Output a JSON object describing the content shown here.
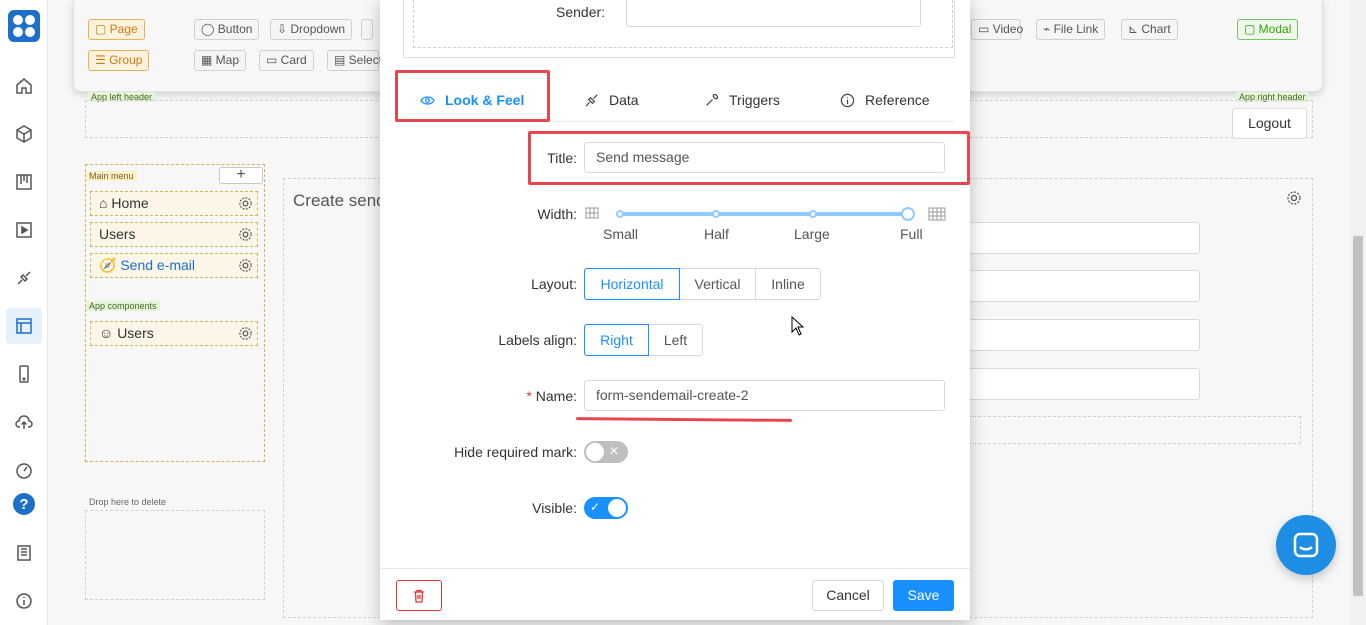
{
  "palette": {
    "page": "Page",
    "group": "Group",
    "button": "Button",
    "dropdown": "Dropdown",
    "map": "Map",
    "card": "Card",
    "select": "Select",
    "video": "Video",
    "file_link": "File Link",
    "chart": "Chart",
    "modal": "Modal"
  },
  "layout": {
    "app_left_header": "App left header",
    "app_right_header": "App right header",
    "logout": "Logout",
    "main_menu": "Main menu",
    "app_components": "App components",
    "drop_to_delete": "Drop here to delete",
    "create_send_title": "Create send"
  },
  "menu": [
    "Home",
    "Users",
    "Send e-mail"
  ],
  "components": [
    "Users"
  ],
  "modal": {
    "sender_label": "Sender:",
    "tabs": [
      "Look & Feel",
      "Data",
      "Triggers",
      "Reference"
    ],
    "title_label": "Title:",
    "title_value": "Send message",
    "width_label": "Width:",
    "width_marks": [
      "Small",
      "Half",
      "Large",
      "Full"
    ],
    "width_value": "Full",
    "layout_label": "Layout:",
    "layout_options": [
      "Horizontal",
      "Vertical",
      "Inline"
    ],
    "layout_value": "Horizontal",
    "labels_align_label": "Labels align:",
    "labels_align_options": [
      "Right",
      "Left"
    ],
    "labels_align_value": "Right",
    "required_mark": "*",
    "name_label": "Name:",
    "name_value": "form-sendemail-create-2",
    "hide_required_label": "Hide required mark:",
    "hide_required_value": false,
    "visible_label": "Visible:",
    "visible_value": true,
    "cancel": "Cancel",
    "save": "Save"
  },
  "colors": {
    "primary": "#1890ff",
    "annotation": "#e5464f",
    "brand": "#1e6fc9"
  }
}
